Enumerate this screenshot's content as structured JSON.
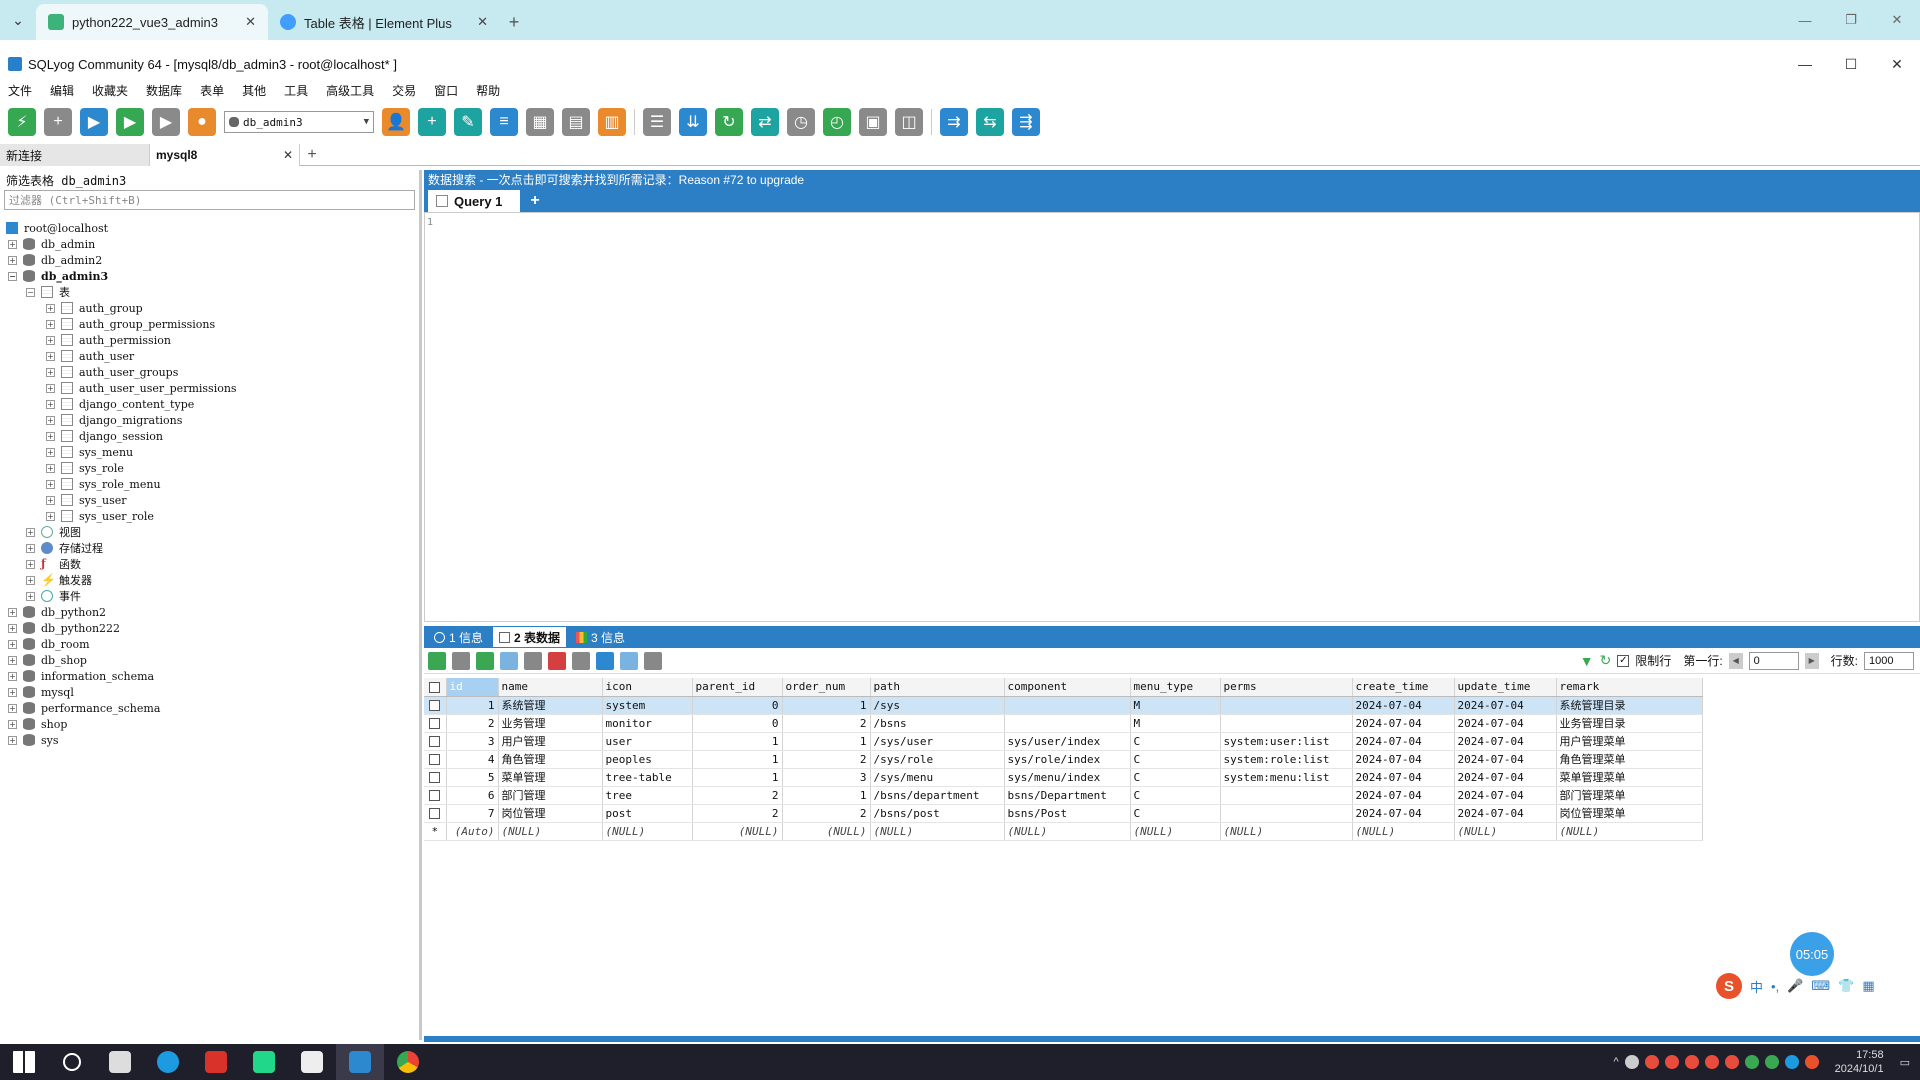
{
  "browser": {
    "tabs": [
      {
        "title": "python222_vue3_admin3",
        "color": "#3bb37a"
      },
      {
        "title": "Table 表格 | Element Plus",
        "color": "#409eff"
      }
    ],
    "new_tab": "+",
    "menu_glyph": "⌄"
  },
  "app": {
    "title": "SQLyog Community 64 - [mysql8/db_admin3 - root@localhost* ]",
    "menu": [
      "文件",
      "编辑",
      "收藏夹",
      "数据库",
      "表单",
      "其他",
      "工具",
      "高级工具",
      "交易",
      "窗口",
      "帮助"
    ],
    "db_select": "db_admin3"
  },
  "conn_tabs": {
    "new": "新连接",
    "active": "mysql8",
    "close": "✕",
    "add": "+"
  },
  "left": {
    "header": "筛选表格 db_admin3",
    "filter_placeholder": "过滤器 (Ctrl+Shift+B)",
    "host": "root@localhost",
    "dbs_before": [
      "db_admin",
      "db_admin2"
    ],
    "active_db": "db_admin3",
    "tables_folder": "表",
    "tables": [
      "auth_group",
      "auth_group_permissions",
      "auth_permission",
      "auth_user",
      "auth_user_groups",
      "auth_user_user_permissions",
      "django_content_type",
      "django_migrations",
      "django_session",
      "sys_menu",
      "sys_role",
      "sys_role_menu",
      "sys_user",
      "sys_user_role"
    ],
    "views": "视图",
    "procs": "存储过程",
    "funcs": "函数",
    "triggers": "触发器",
    "events": "事件",
    "dbs_after": [
      "db_python2",
      "db_python222",
      "db_room",
      "db_shop",
      "information_schema",
      "mysql",
      "performance_schema",
      "shop",
      "sys"
    ]
  },
  "right": {
    "banner": "数据搜索 - 一次点击即可搜索并找到所需记录：Reason #72 to upgrade",
    "query_tab": "Query 1",
    "line_no": "1",
    "result_tabs": [
      "1 信息",
      "2 表数据",
      "3 信息"
    ],
    "limit_label": "限制行",
    "first_row_label": "第一行:",
    "first_row": "0",
    "rows_label": "行数:",
    "rows": "1000",
    "columns": [
      "id",
      "name",
      "icon",
      "parent_id",
      "order_num",
      "path",
      "component",
      "menu_type",
      "perms",
      "create_time",
      "update_time",
      "remark"
    ],
    "rows_data": [
      [
        "1",
        "系统管理",
        "system",
        "0",
        "1",
        "/sys",
        "",
        "M",
        "",
        "2024-07-04",
        "2024-07-04",
        "系统管理目录"
      ],
      [
        "2",
        "业务管理",
        "monitor",
        "0",
        "2",
        "/bsns",
        "",
        "M",
        "",
        "2024-07-04",
        "2024-07-04",
        "业务管理目录"
      ],
      [
        "3",
        "用户管理",
        "user",
        "1",
        "1",
        "/sys/user",
        "sys/user/index",
        "C",
        "system:user:list",
        "2024-07-04",
        "2024-07-04",
        "用户管理菜单"
      ],
      [
        "4",
        "角色管理",
        "peoples",
        "1",
        "2",
        "/sys/role",
        "sys/role/index",
        "C",
        "system:role:list",
        "2024-07-04",
        "2024-07-04",
        "角色管理菜单"
      ],
      [
        "5",
        "菜单管理",
        "tree-table",
        "1",
        "3",
        "/sys/menu",
        "sys/menu/index",
        "C",
        "system:menu:list",
        "2024-07-04",
        "2024-07-04",
        "菜单管理菜单"
      ],
      [
        "6",
        "部门管理",
        "tree",
        "2",
        "1",
        "/bsns/department",
        "bsns/Department",
        "C",
        "",
        "2024-07-04",
        "2024-07-04",
        "部门管理菜单"
      ],
      [
        "7",
        "岗位管理",
        "post",
        "2",
        "2",
        "/bsns/post",
        "bsns/Post",
        "C",
        "",
        "2024-07-04",
        "2024-07-04",
        "岗位管理菜单"
      ]
    ],
    "new_row": [
      "*",
      "(Auto)",
      "(NULL)",
      "(NULL)",
      "(NULL)",
      "(NULL)",
      "(NULL)",
      "(NULL)",
      "(NULL)",
      "(NULL)",
      "(NULL)",
      "(NULL)",
      "(NULL)"
    ]
  },
  "widgets": {
    "timer": "05:05",
    "ime_s": "S",
    "ime_lang": "中"
  },
  "taskbar": {
    "time": "17:58",
    "date": "2024/10/1"
  }
}
